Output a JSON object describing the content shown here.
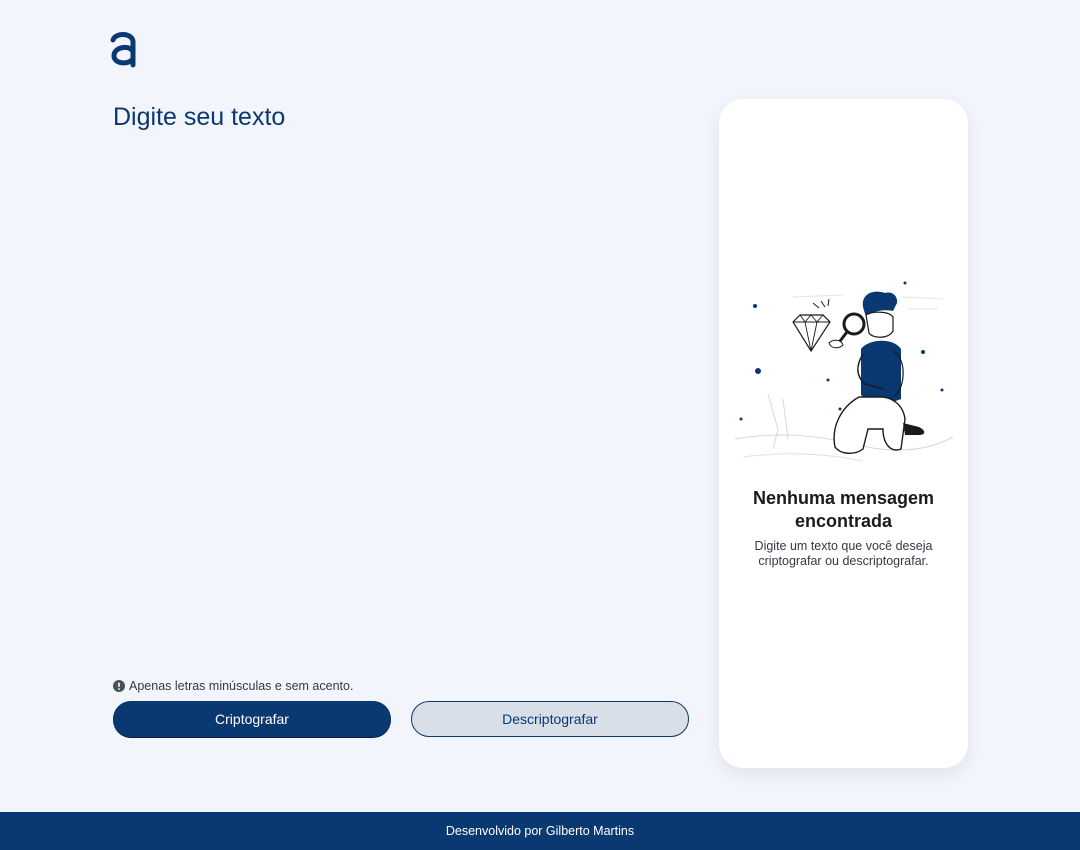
{
  "logo": {
    "icon": "alura-logo-icon",
    "color": "#0a3871"
  },
  "input": {
    "placeholder": "Digite seu texto",
    "value": ""
  },
  "warning": {
    "icon": "exclamation-circle-icon",
    "text": "Apenas letras minúsculas e sem acento."
  },
  "buttons": {
    "encrypt_label": "Criptografar",
    "decrypt_label": "Descriptografar"
  },
  "output": {
    "illustration": "person-with-magnifying-glass-illustration",
    "title": "Nenhuma mensagem encontrada",
    "message": "Digite um texto que você deseja criptografar ou descriptografar."
  },
  "footer": {
    "text": "Desenvolvido por Gilberto Martins"
  },
  "colors": {
    "primary": "#0a3871",
    "background": "#f3f5fc",
    "secondary_button": "#d8dfe8"
  }
}
